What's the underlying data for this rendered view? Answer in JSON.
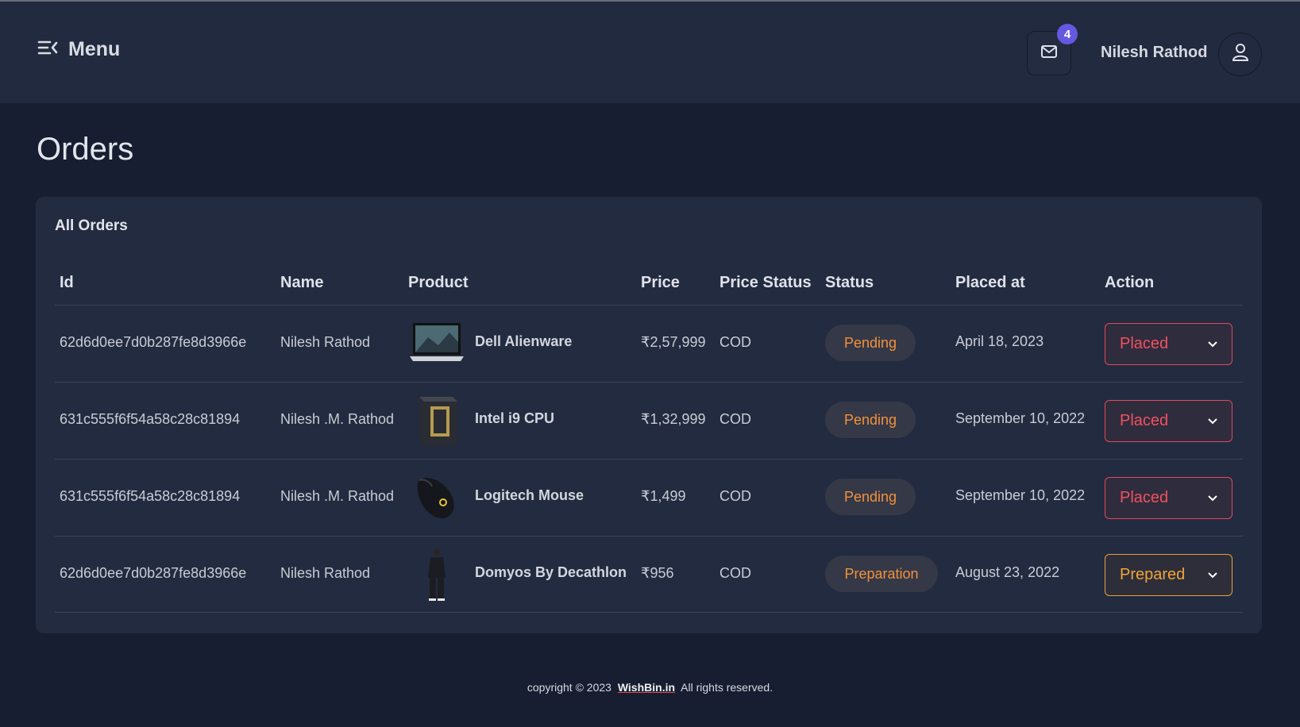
{
  "header": {
    "menu_label": "Menu",
    "notification_count": "4",
    "user_name": "Nilesh Rathod"
  },
  "page": {
    "title": "Orders"
  },
  "orders_card": {
    "title": "All Orders",
    "columns": [
      "Id",
      "Name",
      "Product",
      "Price",
      "Price Status",
      "Status",
      "Placed at",
      "Action"
    ],
    "rows": [
      {
        "id": "62d6d0ee7d0b287fe8d3966e",
        "name": "Nilesh Rathod",
        "product": "Dell Alienware",
        "price": "₹2,57,999",
        "price_status": "COD",
        "status": "Pending",
        "placed_at": "April 18, 2023",
        "action": "Placed"
      },
      {
        "id": "631c555f6f54a58c28c81894",
        "name": "Nilesh .M. Rathod",
        "product": "Intel i9 CPU",
        "price": "₹1,32,999",
        "price_status": "COD",
        "status": "Pending",
        "placed_at": "September 10, 2022",
        "action": "Placed"
      },
      {
        "id": "631c555f6f54a58c28c81894",
        "name": "Nilesh .M. Rathod",
        "product": "Logitech Mouse",
        "price": "₹1,499",
        "price_status": "COD",
        "status": "Pending",
        "placed_at": "September 10, 2022",
        "action": "Placed"
      },
      {
        "id": "62d6d0ee7d0b287fe8d3966e",
        "name": "Nilesh Rathod",
        "product": "Domyos By Decathlon",
        "price": "₹956",
        "price_status": "COD",
        "status": "Preparation",
        "placed_at": "August 23, 2022",
        "action": "Prepared"
      }
    ]
  },
  "footer": {
    "prefix": "copyright © 2023",
    "link": "WishBin.in",
    "suffix": "All rights reserved."
  },
  "colors": {
    "page_bg": "#171e31",
    "header_bg": "#222a3f",
    "card_bg": "#232b40",
    "badge": "#6658e0",
    "pending_text": "#f2913b",
    "placed": "#e04a5c",
    "prepared": "#e7a13c"
  }
}
